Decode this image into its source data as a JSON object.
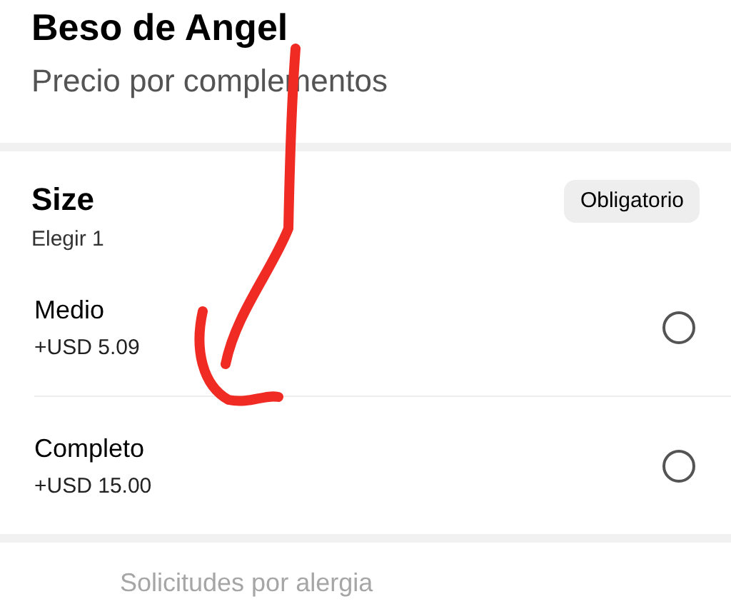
{
  "header": {
    "title": "Beso de Angel",
    "subtitle": "Precio por complementos"
  },
  "section": {
    "title": "Size",
    "hint": "Elegir 1",
    "badge": "Obligatorio",
    "options": [
      {
        "label": "Medio",
        "price": "+USD 5.09",
        "selected": false
      },
      {
        "label": "Completo",
        "price": "+USD 15.00",
        "selected": false
      }
    ]
  },
  "allergy_link": "Solicitudes por alergia"
}
